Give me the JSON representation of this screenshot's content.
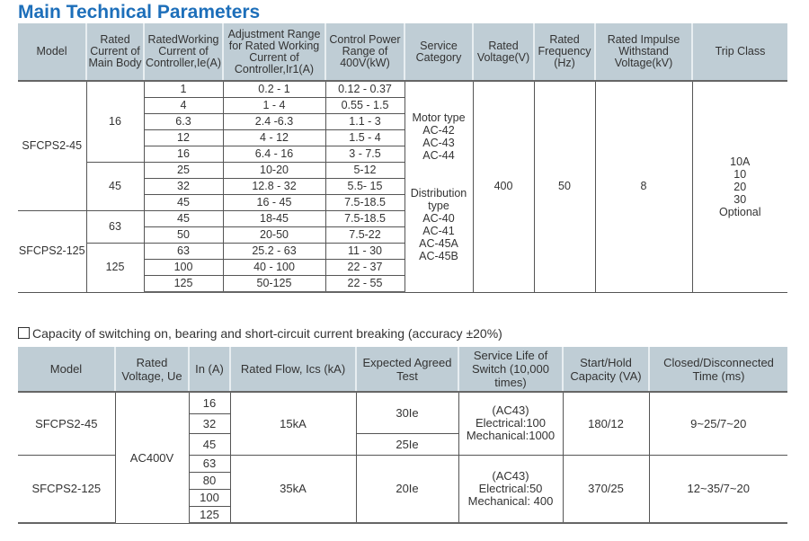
{
  "title": "Main Technical Parameters",
  "table1": {
    "headers": [
      "Model",
      "Rated Current of Main Body",
      "RatedWorking Current of Controller,Ie(A)",
      "Adjustment Range for Rated Working Current of Controller,Ir1(A)",
      "Control Power Range of 400V(kW)",
      "Service Category",
      "Rated Voltage(V)",
      "Rated Frequency (Hz)",
      "Rated Impulse Withstand Voltage(kV)",
      "Trip Class"
    ],
    "models": [
      "SFCPS2-45",
      "SFCPS2-125"
    ],
    "main_body": [
      "16",
      "45",
      "63",
      "125"
    ],
    "rows": [
      {
        "ie": "1",
        "range": "0.2 - 1",
        "power": "0.12 - 0.37"
      },
      {
        "ie": "4",
        "range": "1 - 4",
        "power": "0.55 - 1.5"
      },
      {
        "ie": "6.3",
        "range": "2.4 -6.3",
        "power": "1.1 - 3"
      },
      {
        "ie": "12",
        "range": "4 - 12",
        "power": "1.5 - 4"
      },
      {
        "ie": "16",
        "range": "6.4 - 16",
        "power": "3 - 7.5"
      },
      {
        "ie": "25",
        "range": "10-20",
        "power": "5-12"
      },
      {
        "ie": "32",
        "range": "12.8 - 32",
        "power": "5.5- 15"
      },
      {
        "ie": "45",
        "range": "16 - 45",
        "power": "7.5-18.5"
      },
      {
        "ie": "45",
        "range": "18-45",
        "power": "7.5-18.5"
      },
      {
        "ie": "50",
        "range": "20-50",
        "power": "7.5-22"
      },
      {
        "ie": "63",
        "range": "25.2 - 63",
        "power": "11 - 30"
      },
      {
        "ie": "100",
        "range": "40 - 100",
        "power": "22 - 37"
      },
      {
        "ie": "125",
        "range": "50-125",
        "power": "22 - 55"
      }
    ],
    "service_category": {
      "motor": [
        "Motor type",
        "AC-42",
        "AC-43",
        "AC-44"
      ],
      "distribution": [
        "Distribution",
        "type",
        "AC-40",
        "AC-41",
        "AC-45A",
        "AC-45B"
      ]
    },
    "rated_voltage": "400",
    "rated_frequency": "50",
    "impulse_voltage": "8",
    "trip_class": [
      "10A",
      "10",
      "20",
      "30",
      "Optional"
    ]
  },
  "subtitle": "Capacity of switching on, bearing and short-circuit current breaking (accuracy ±20%)",
  "table2": {
    "headers": [
      "Model",
      "Rated Voltage, Ue",
      "In (A)",
      "Rated Flow, Ics (kA)",
      "Expected Agreed Test",
      "Service Life of Switch (10,000 times)",
      "Start/Hold Capacity (VA)",
      "Closed/Disconnected Time (ms)"
    ],
    "voltage": "AC400V",
    "groups": [
      {
        "model": "SFCPS2-45",
        "in": [
          "16",
          "32",
          "45"
        ],
        "ics": "15kA",
        "tests": [
          "30Ie",
          "25Ie"
        ],
        "life": [
          "(AC43)",
          "Electrical:100",
          "Mechanical:1000"
        ],
        "capacity": "180/12",
        "time": "9~25/7~20"
      },
      {
        "model": "SFCPS2-125",
        "in": [
          "63",
          "80",
          "100",
          "125"
        ],
        "ics": "35kA",
        "tests": [
          "20Ie"
        ],
        "life": [
          "(AC43)",
          "Electrical:50",
          "Mechanical: 400"
        ],
        "capacity": "370/25",
        "time": "12~35/7~20"
      }
    ]
  }
}
